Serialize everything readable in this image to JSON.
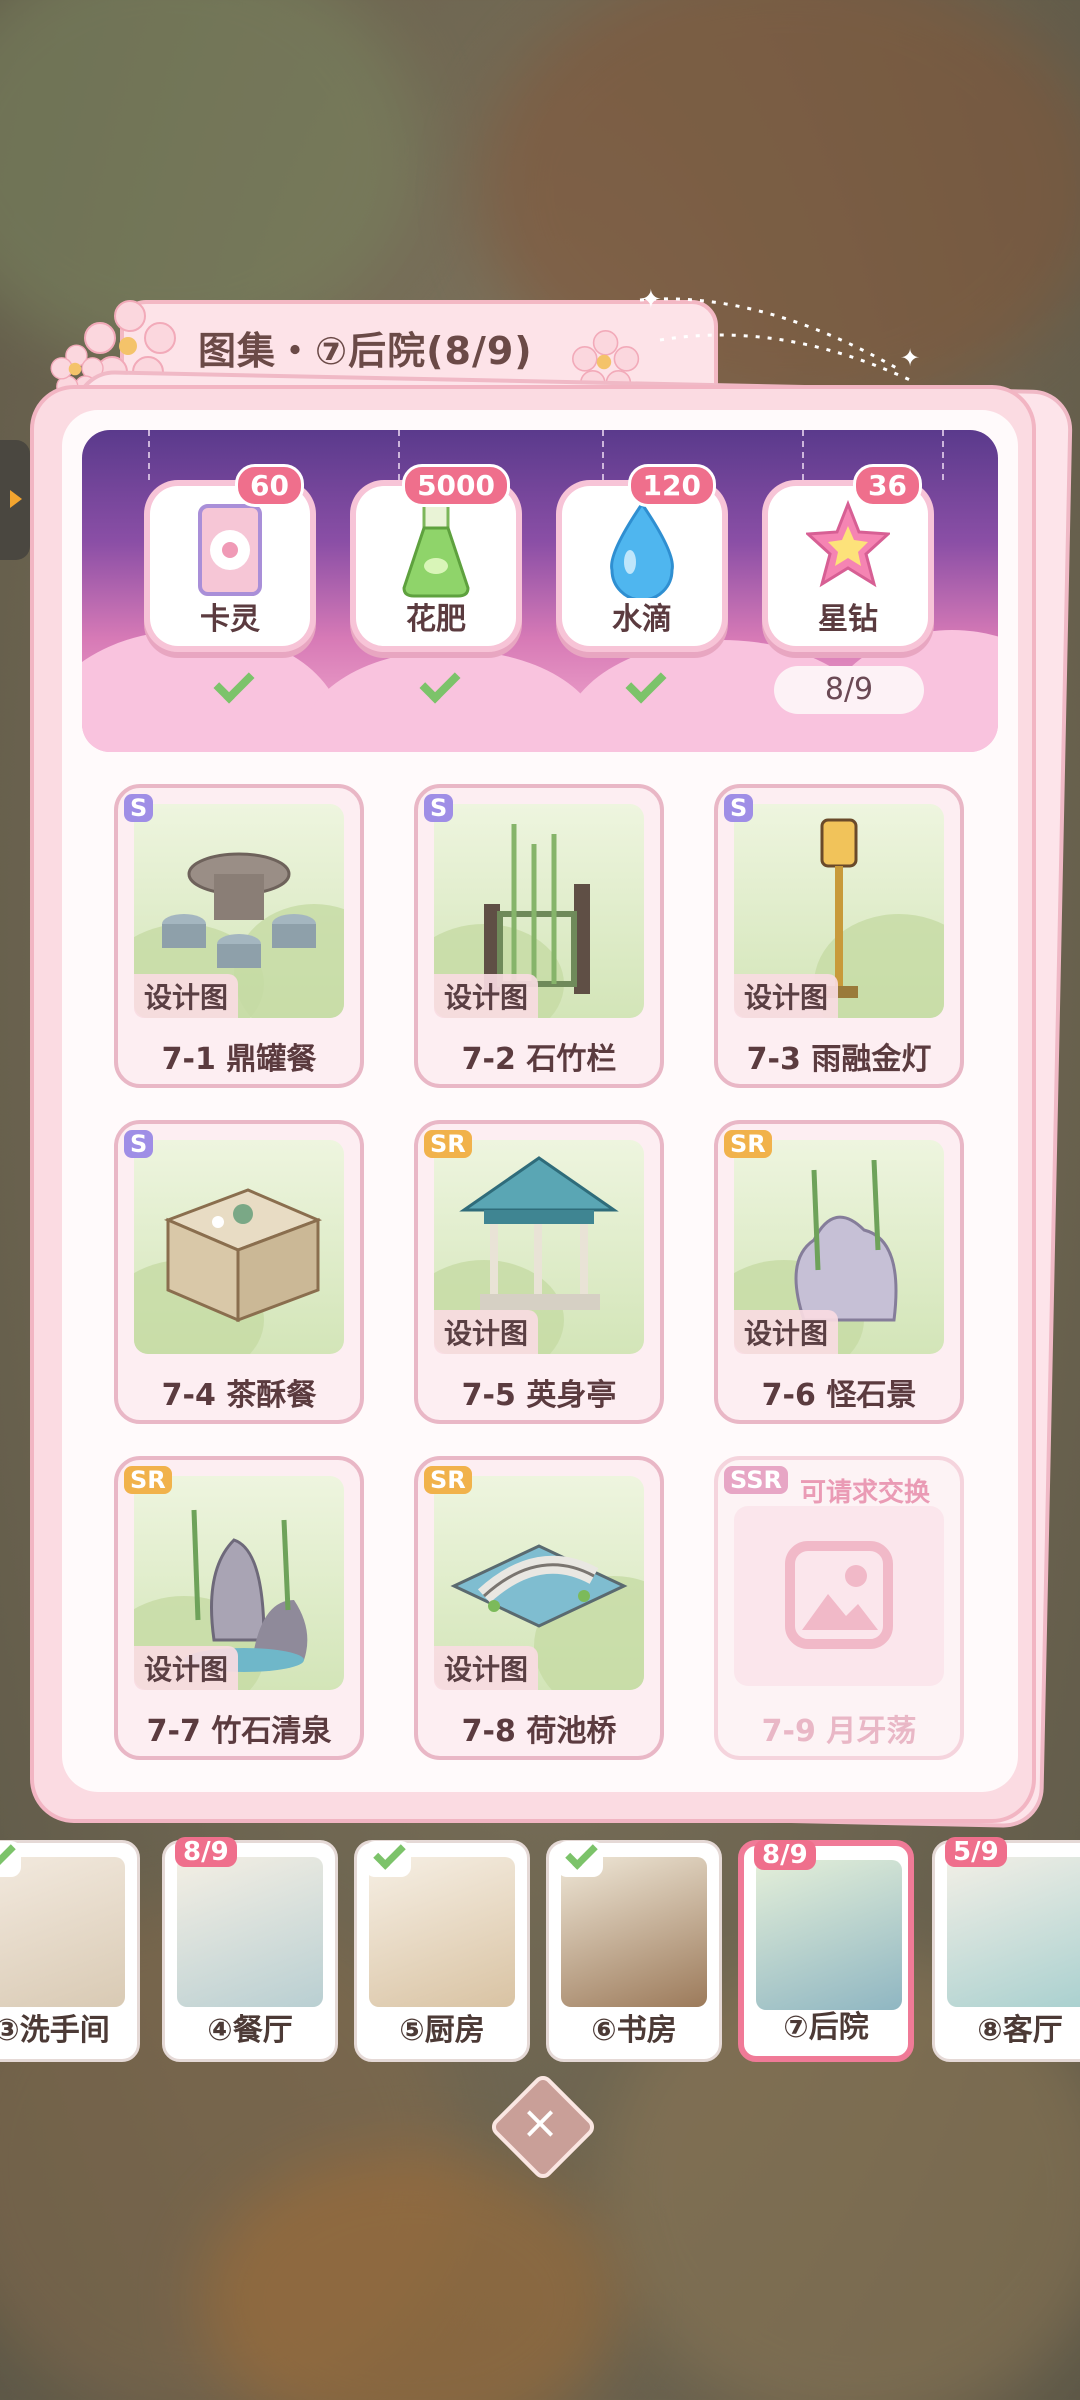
{
  "gallery": {
    "title": "图集・⑦后院(8/9)"
  },
  "rewards": [
    {
      "label": "卡灵",
      "count": "60",
      "claimed": true,
      "icon": "card-spirit-icon"
    },
    {
      "label": "花肥",
      "count": "5000",
      "claimed": true,
      "icon": "fertilizer-flask-icon"
    },
    {
      "label": "水滴",
      "count": "120",
      "claimed": true,
      "icon": "water-drop-icon"
    },
    {
      "label": "星钻",
      "count": "36",
      "claimed": false,
      "icon": "star-diamond-icon",
      "progress": "8/9"
    }
  ],
  "items": [
    {
      "rarity": "S",
      "tag": "设计图",
      "name": "7-1 鼎罐餐"
    },
    {
      "rarity": "S",
      "tag": "设计图",
      "name": "7-2 石竹栏"
    },
    {
      "rarity": "S",
      "tag": "设计图",
      "name": "7-3 雨融金灯"
    },
    {
      "rarity": "S",
      "tag": "",
      "name": "7-4 茶酥餐"
    },
    {
      "rarity": "SR",
      "tag": "设计图",
      "name": "7-5 英身亭"
    },
    {
      "rarity": "SR",
      "tag": "设计图",
      "name": "7-6 怪石景"
    },
    {
      "rarity": "SR",
      "tag": "设计图",
      "name": "7-7 竹石清泉"
    },
    {
      "rarity": "SR",
      "tag": "设计图",
      "name": "7-8 荷池桥"
    },
    {
      "rarity": "SSR",
      "tag": "可请求交换",
      "name": "7-9 月牙荡",
      "locked": true
    }
  ],
  "rooms": [
    {
      "label": "③洗手间",
      "status": "check"
    },
    {
      "label": "④餐厅",
      "status": "8/9"
    },
    {
      "label": "⑤厨房",
      "status": "check"
    },
    {
      "label": "⑥书房",
      "status": "check"
    },
    {
      "label": "⑦后院",
      "status": "8/9",
      "active": true
    },
    {
      "label": "⑧客厅",
      "status": "5/9"
    }
  ],
  "colors": {
    "accent_pink": "#ef6f8c",
    "check_green": "#7cc36a",
    "rarity_s": "#9f8ee6",
    "rarity_sr": "#f1b24b",
    "rarity_ssr": "#e7a6c5"
  }
}
